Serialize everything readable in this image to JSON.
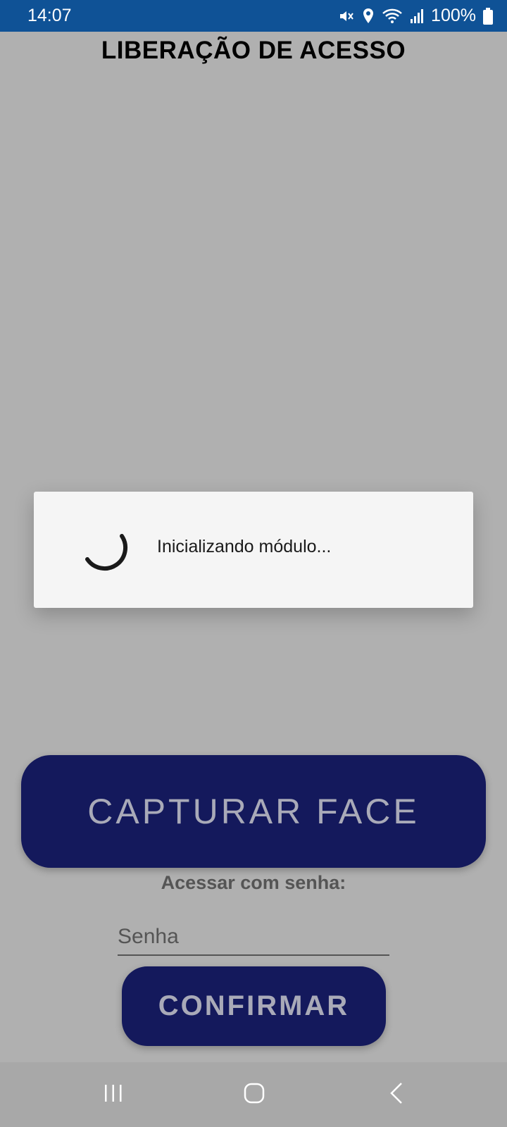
{
  "status_bar": {
    "time": "14:07",
    "battery": "100%",
    "icons": [
      "mute-icon",
      "location-icon",
      "wifi-icon",
      "signal-icon",
      "battery-icon"
    ]
  },
  "header": {
    "title": "LIBERAÇÃO DE ACESSO"
  },
  "dialog": {
    "message": "Inicializando módulo..."
  },
  "main": {
    "capture_button_label": "CAPTURAR FACE",
    "password_prompt": "Acessar com senha:",
    "password_placeholder": "Senha",
    "confirm_button_label": "CONFIRMAR"
  },
  "nav_bar": {
    "icons": [
      "recent-apps-icon",
      "home-icon",
      "back-icon"
    ]
  },
  "colors": {
    "status_bar": "#0f5296",
    "button_bg": "#14195c",
    "button_text": "#a9aab8",
    "overlay_bg": "#b0b0b0"
  }
}
